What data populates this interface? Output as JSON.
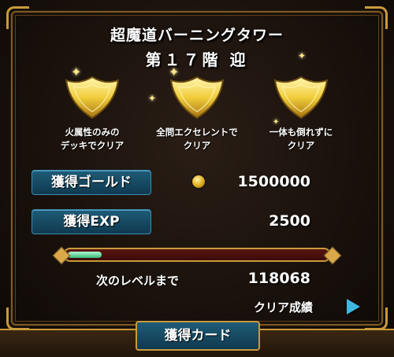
{
  "header": {
    "title": "超魔道バーニングタワー",
    "floor": "第１７階 迎"
  },
  "medals": [
    {
      "line1": "火属性のみの",
      "line2": "デッキでクリア"
    },
    {
      "line1": "全問エクセレントで",
      "line2": "クリア"
    },
    {
      "line1": "一体も倒れずに",
      "line2": "クリア"
    }
  ],
  "rewards": {
    "gold_label": "獲得ゴールド",
    "gold_value": "1500000",
    "exp_label": "獲得EXP",
    "exp_value": "2500"
  },
  "exp_bar": {
    "progress": 0.13,
    "next_level_label": "次のレベルまで",
    "next_level_value": "118068"
  },
  "clear_record_label": "クリア成績",
  "card_tab_label": "獲得カード",
  "colors": {
    "gold": "#c99a3c",
    "label_blue": "#1f5b77",
    "bar_red": "#5a1512",
    "bar_green": "#37b97c",
    "arrow_blue": "#3fb7e0"
  }
}
